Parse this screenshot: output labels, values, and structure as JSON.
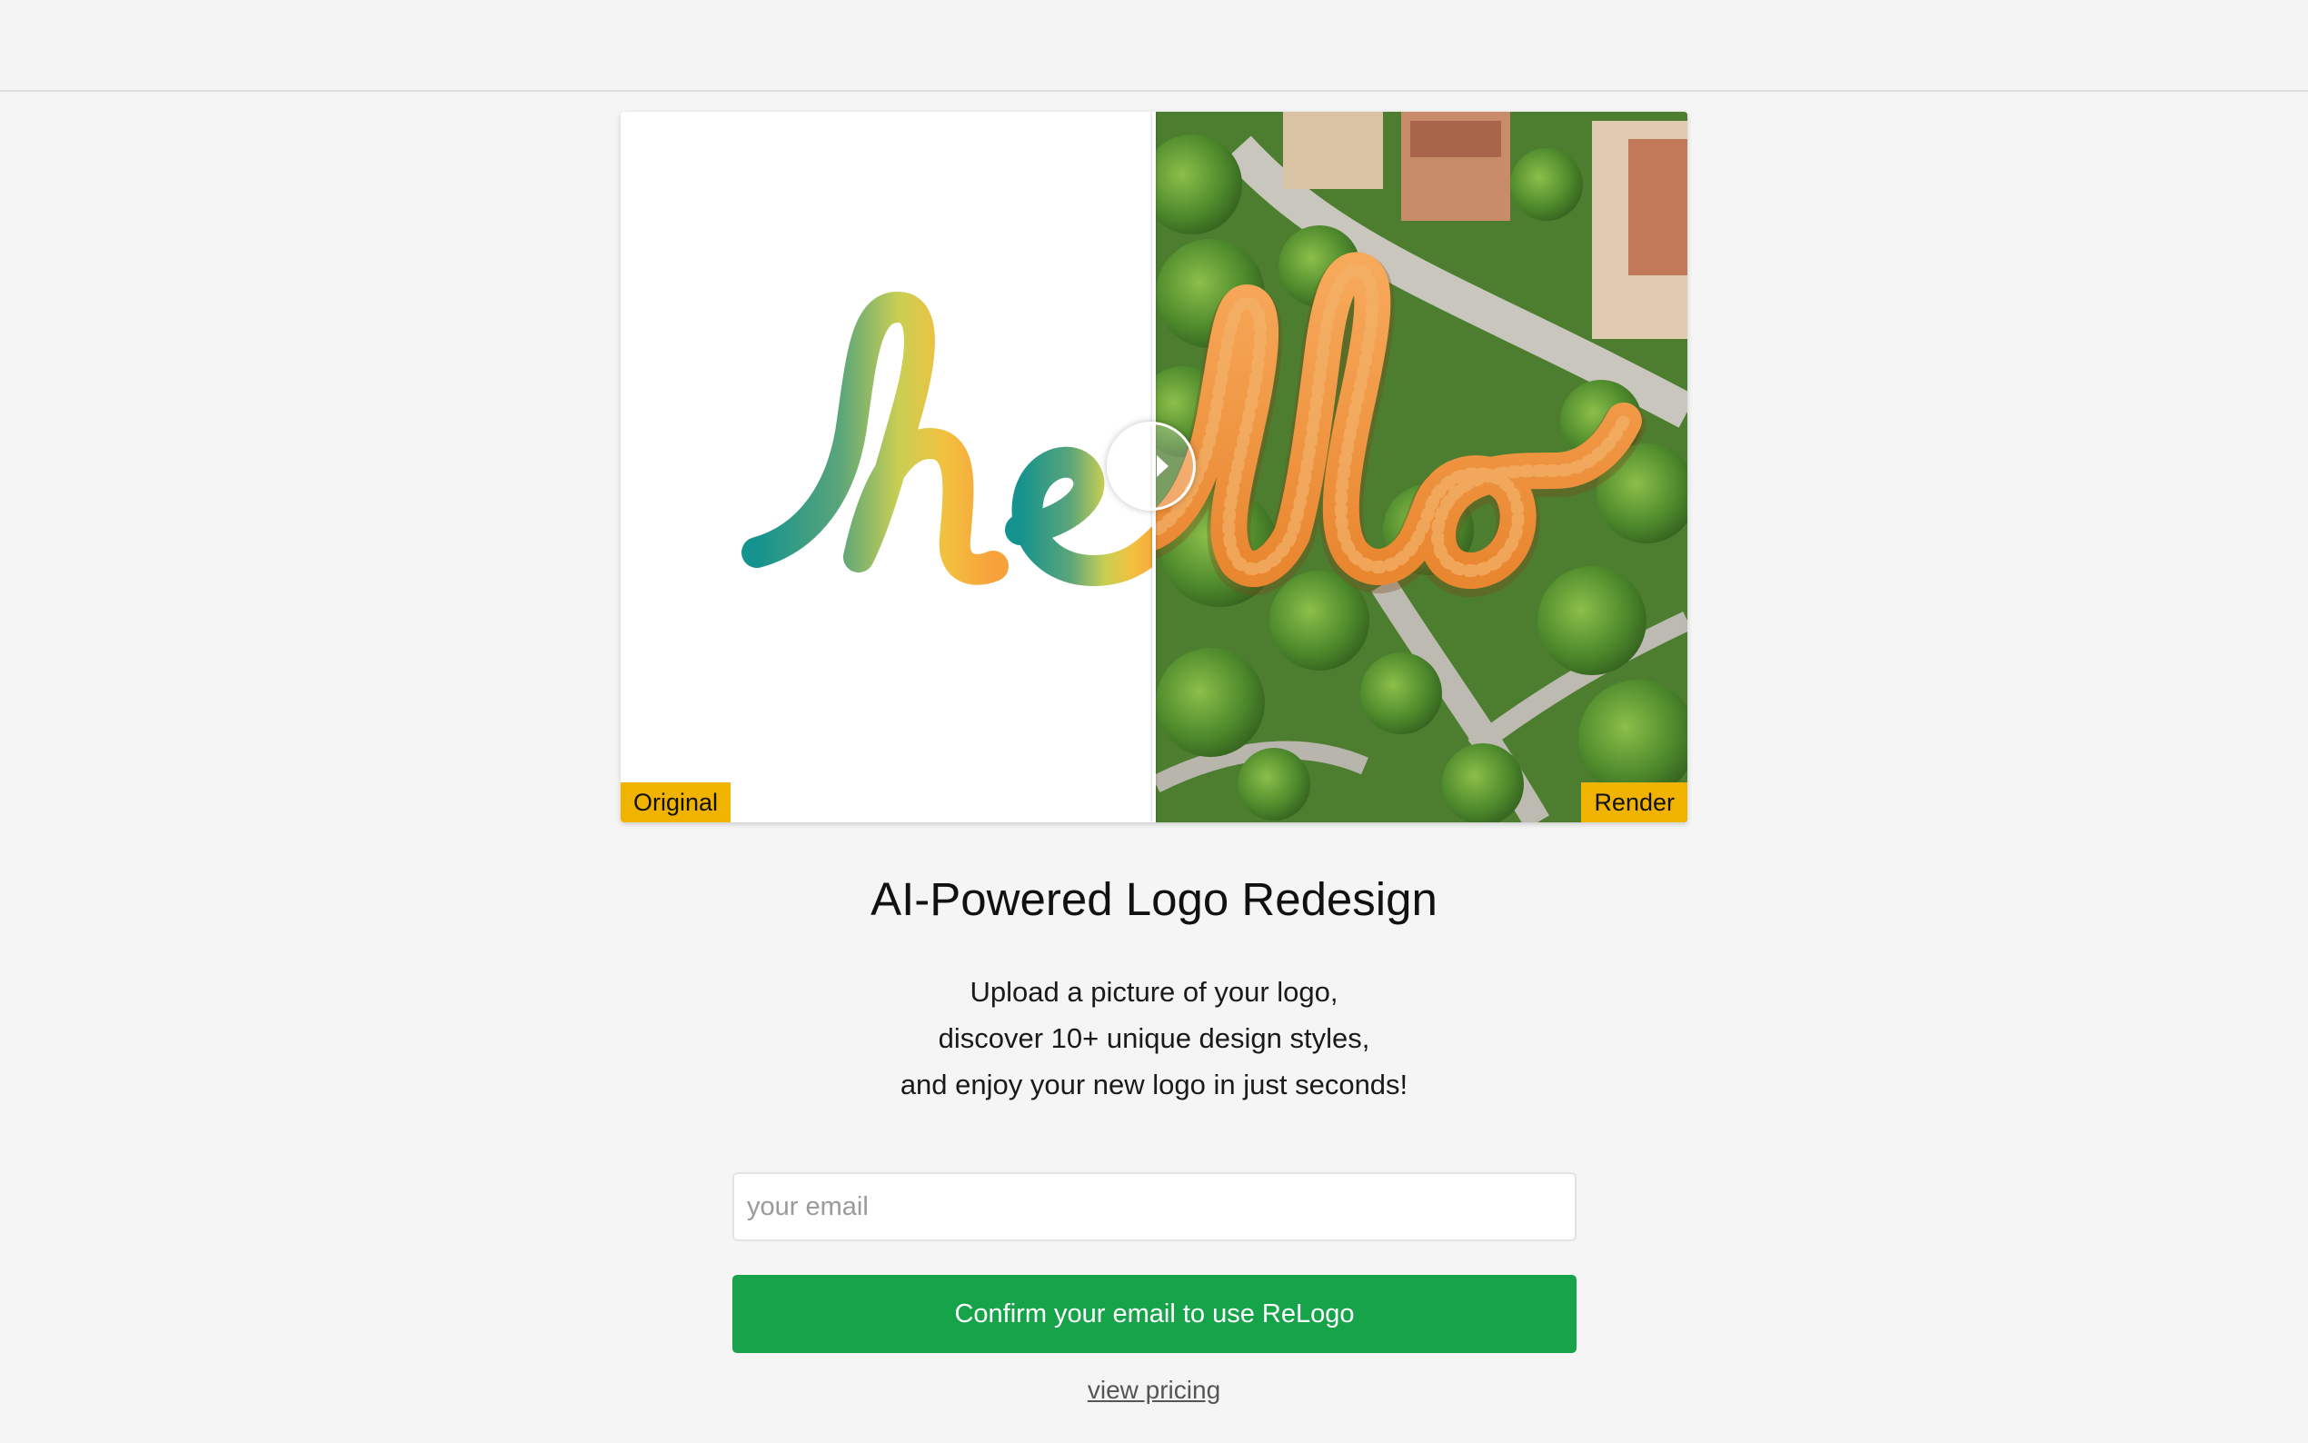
{
  "colors": {
    "page_background": "#f5f5f5",
    "tag_background": "#f0b400",
    "button_background": "#16a34a",
    "button_text": "#ffffff"
  },
  "comparison": {
    "left_tag": "Original",
    "right_tag": "Render",
    "handle_icon": "left-right-arrows-icon"
  },
  "hero": {
    "title": "AI-Powered Logo Redesign",
    "subtitle_lines": [
      "Upload a picture of your logo,",
      "discover 10+ unique design styles,",
      "and enjoy your new logo in just seconds!"
    ]
  },
  "form": {
    "email_placeholder": "your email",
    "confirm_label": "Confirm your email to use ReLogo",
    "pricing_link": "view pricing"
  }
}
